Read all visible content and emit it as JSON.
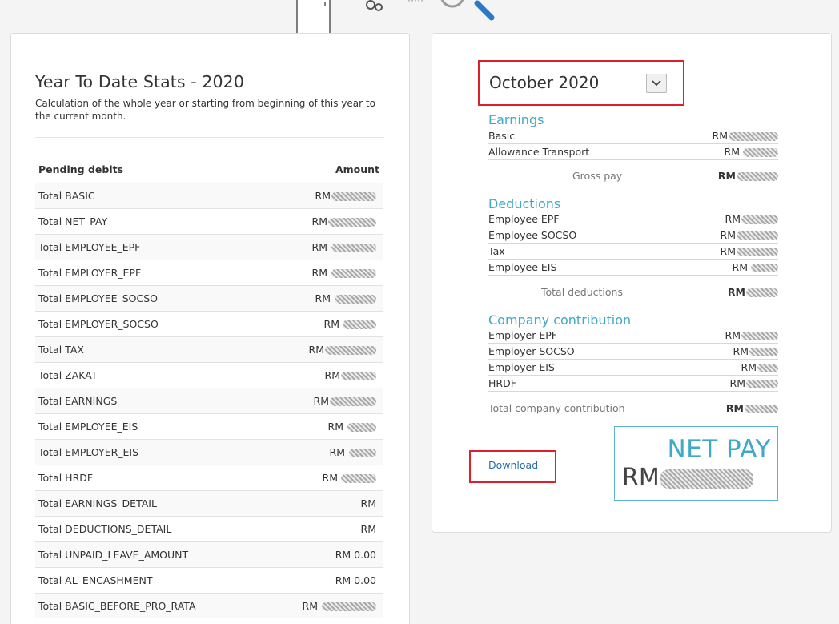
{
  "ytd": {
    "title": "Year To Date Stats - 2020",
    "subtitle": "Calculation of the whole year or starting from beginning of this year to the current month.",
    "col_label": "Pending debits",
    "col_amount": "Amount",
    "rows": [
      {
        "label": "Total BASIC",
        "amount": "RM"
      },
      {
        "label": "Total NET_PAY",
        "amount": "RM"
      },
      {
        "label": "Total EMPLOYEE_EPF",
        "amount": "RM"
      },
      {
        "label": "Total EMPLOYER_EPF",
        "amount": "RM"
      },
      {
        "label": "Total EMPLOYEE_SOCSO",
        "amount": "RM"
      },
      {
        "label": "Total EMPLOYER_SOCSO",
        "amount": "RM"
      },
      {
        "label": "Total TAX",
        "amount": "RM"
      },
      {
        "label": "Total ZAKAT",
        "amount": "RM"
      },
      {
        "label": "Total EARNINGS",
        "amount": "RM"
      },
      {
        "label": "Total EMPLOYEE_EIS",
        "amount": "RM"
      },
      {
        "label": "Total EMPLOYER_EIS",
        "amount": "RM"
      },
      {
        "label": "Total HRDF",
        "amount": "RM"
      },
      {
        "label": "Total EARNINGS_DETAIL",
        "amount": "RM"
      },
      {
        "label": "Total DEDUCTIONS_DETAIL",
        "amount": "RM"
      },
      {
        "label": "Total UNPAID_LEAVE_AMOUNT",
        "amount": "RM 0.00"
      },
      {
        "label": "Total AL_ENCASHMENT",
        "amount": "RM 0.00"
      },
      {
        "label": "Total BASIC_BEFORE_PRO_RATA",
        "amount": "RM"
      }
    ]
  },
  "payslip": {
    "month": "October 2020",
    "earnings": {
      "title": "Earnings",
      "items": [
        {
          "label": "Basic",
          "amount": "RM"
        },
        {
          "label": "Allowance Transport",
          "amount": "RM"
        }
      ],
      "total_label": "Gross pay",
      "total_amount": "RM"
    },
    "deductions": {
      "title": "Deductions",
      "items": [
        {
          "label": "Employee EPF",
          "amount": "RM"
        },
        {
          "label": "Employee SOCSO",
          "amount": "RM"
        },
        {
          "label": "Tax",
          "amount": "RM"
        },
        {
          "label": "Employee EIS",
          "amount": "RM"
        }
      ],
      "total_label": "Total deductions",
      "total_amount": "RM"
    },
    "company": {
      "title": "Company contribution",
      "items": [
        {
          "label": "Employer EPF",
          "amount": "RM"
        },
        {
          "label": "Employer SOCSO",
          "amount": "RM"
        },
        {
          "label": "Employer EIS",
          "amount": "RM"
        },
        {
          "label": "HRDF",
          "amount": "RM"
        }
      ],
      "total_label": "Total company contribution",
      "total_amount": "RM"
    },
    "download_label": "Download",
    "net_pay_label": "NET PAY",
    "net_pay_amount": "RM"
  },
  "colors": {
    "accent": "#3fa9c6",
    "highlight": "#e01f2b",
    "link": "#2a6fa8"
  },
  "icons": [
    "document-icon",
    "gear-icon",
    "magnifier-icon",
    "chevron-down-icon"
  ]
}
